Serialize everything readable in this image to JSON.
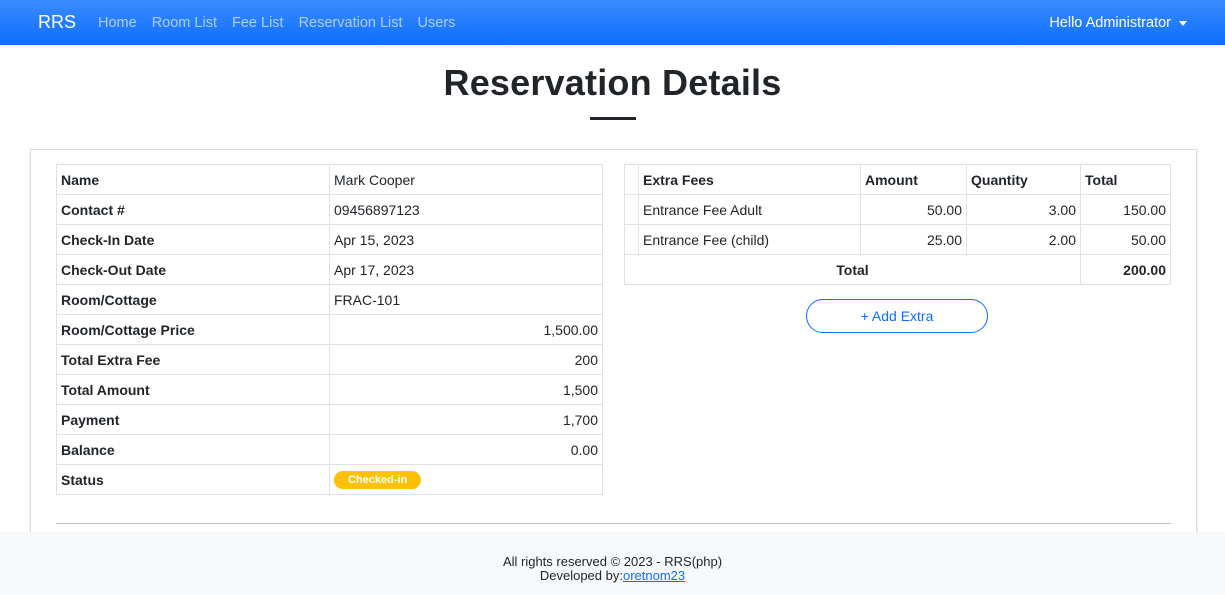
{
  "navbar": {
    "brand": "RRS",
    "links": [
      "Home",
      "Room List",
      "Fee List",
      "Reservation List",
      "Users"
    ],
    "user_greeting": "Hello Administrator"
  },
  "page": {
    "title": "Reservation Details"
  },
  "details": {
    "rows": [
      {
        "label": "Name",
        "value": "Mark Cooper"
      },
      {
        "label": "Contact #",
        "value": "09456897123"
      },
      {
        "label": "Check-In Date",
        "value": "Apr 15, 2023"
      },
      {
        "label": "Check-Out Date",
        "value": "Apr 17, 2023"
      },
      {
        "label": "Room/Cottage",
        "value": "FRAC-101"
      },
      {
        "label": "Room/Cottage Price",
        "value": "1,500.00"
      },
      {
        "label": "Total Extra Fee",
        "value": "200"
      },
      {
        "label": "Total Amount",
        "value": "1,500"
      },
      {
        "label": "Payment",
        "value": "1,700"
      },
      {
        "label": "Balance",
        "value": "0.00"
      },
      {
        "label": "Status",
        "value": "Checked-in"
      }
    ]
  },
  "extra_fees": {
    "headers": [
      "Extra Fees",
      "Amount",
      "Quantity",
      "Total"
    ],
    "rows": [
      {
        "name": "Entrance Fee Adult",
        "amount": "50.00",
        "quantity": "3.00",
        "total": "150.00"
      },
      {
        "name": "Entrance Fee (child)",
        "amount": "25.00",
        "quantity": "2.00",
        "total": "50.00"
      }
    ],
    "total_label": "Total",
    "total_value": "200.00",
    "add_button": "+ Add Extra"
  },
  "footer": {
    "line1": "All rights reserved © 2023 - RRS(php)",
    "line2_prefix": "Developed by:",
    "developer": "oretnom23"
  },
  "colors": {
    "navbar": "#0d6efd",
    "status_badge": "#ffc107",
    "link": "#0d6efd"
  }
}
